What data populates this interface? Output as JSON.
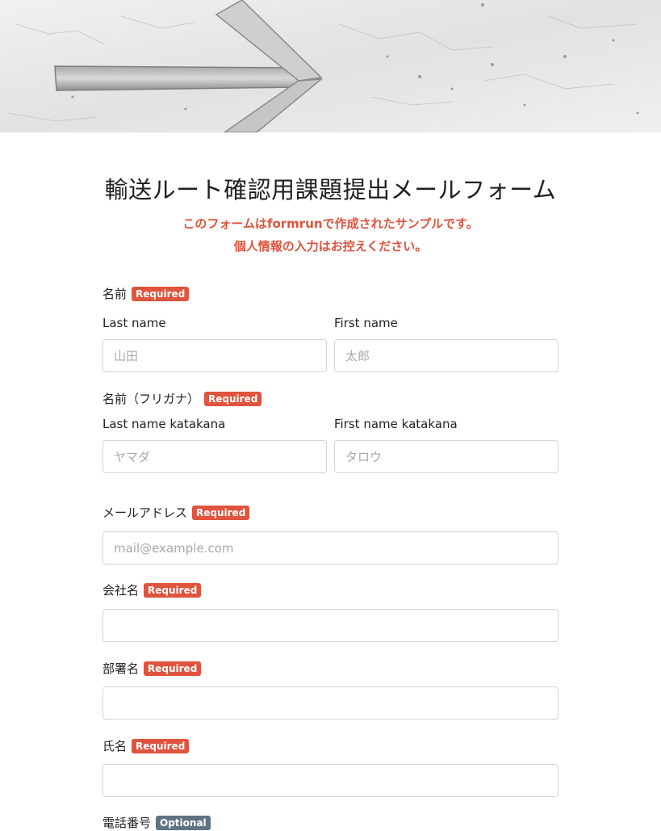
{
  "form": {
    "title": "輸送ルート確認用課題提出メールフォーム",
    "notice_line1_prefix": "このフォームは",
    "notice_brand": "formrun",
    "notice_line1_suffix": "で作成されたサンプルです。",
    "notice_line2": "個人情報の入力はお控えください。"
  },
  "badges": {
    "required": "Required",
    "optional": "Optional"
  },
  "fields": {
    "name": {
      "label": "名前",
      "last_label": "Last name",
      "last_placeholder": "山田",
      "last_value": "",
      "first_label": "First name",
      "first_placeholder": "太郎",
      "first_value": ""
    },
    "kana": {
      "label": "名前（フリガナ）",
      "last_label": "Last name katakana",
      "last_placeholder": "ヤマダ",
      "last_value": "",
      "first_label": "First name katakana",
      "first_placeholder": "タロウ",
      "first_value": ""
    },
    "email": {
      "label": "メールアドレス",
      "placeholder": "mail@example.com",
      "value": ""
    },
    "company": {
      "label": "会社名",
      "placeholder": "",
      "value": ""
    },
    "department": {
      "label": "部署名",
      "placeholder": "",
      "value": ""
    },
    "fullname": {
      "label": "氏名",
      "placeholder": "",
      "value": ""
    },
    "phone": {
      "label": "電話番号"
    }
  },
  "icons": {
    "hero": "arrow-carved-in-concrete"
  },
  "colors": {
    "accent_red": "#e0533d",
    "optional_gray": "#607384",
    "input_border": "#d4d4d4"
  }
}
